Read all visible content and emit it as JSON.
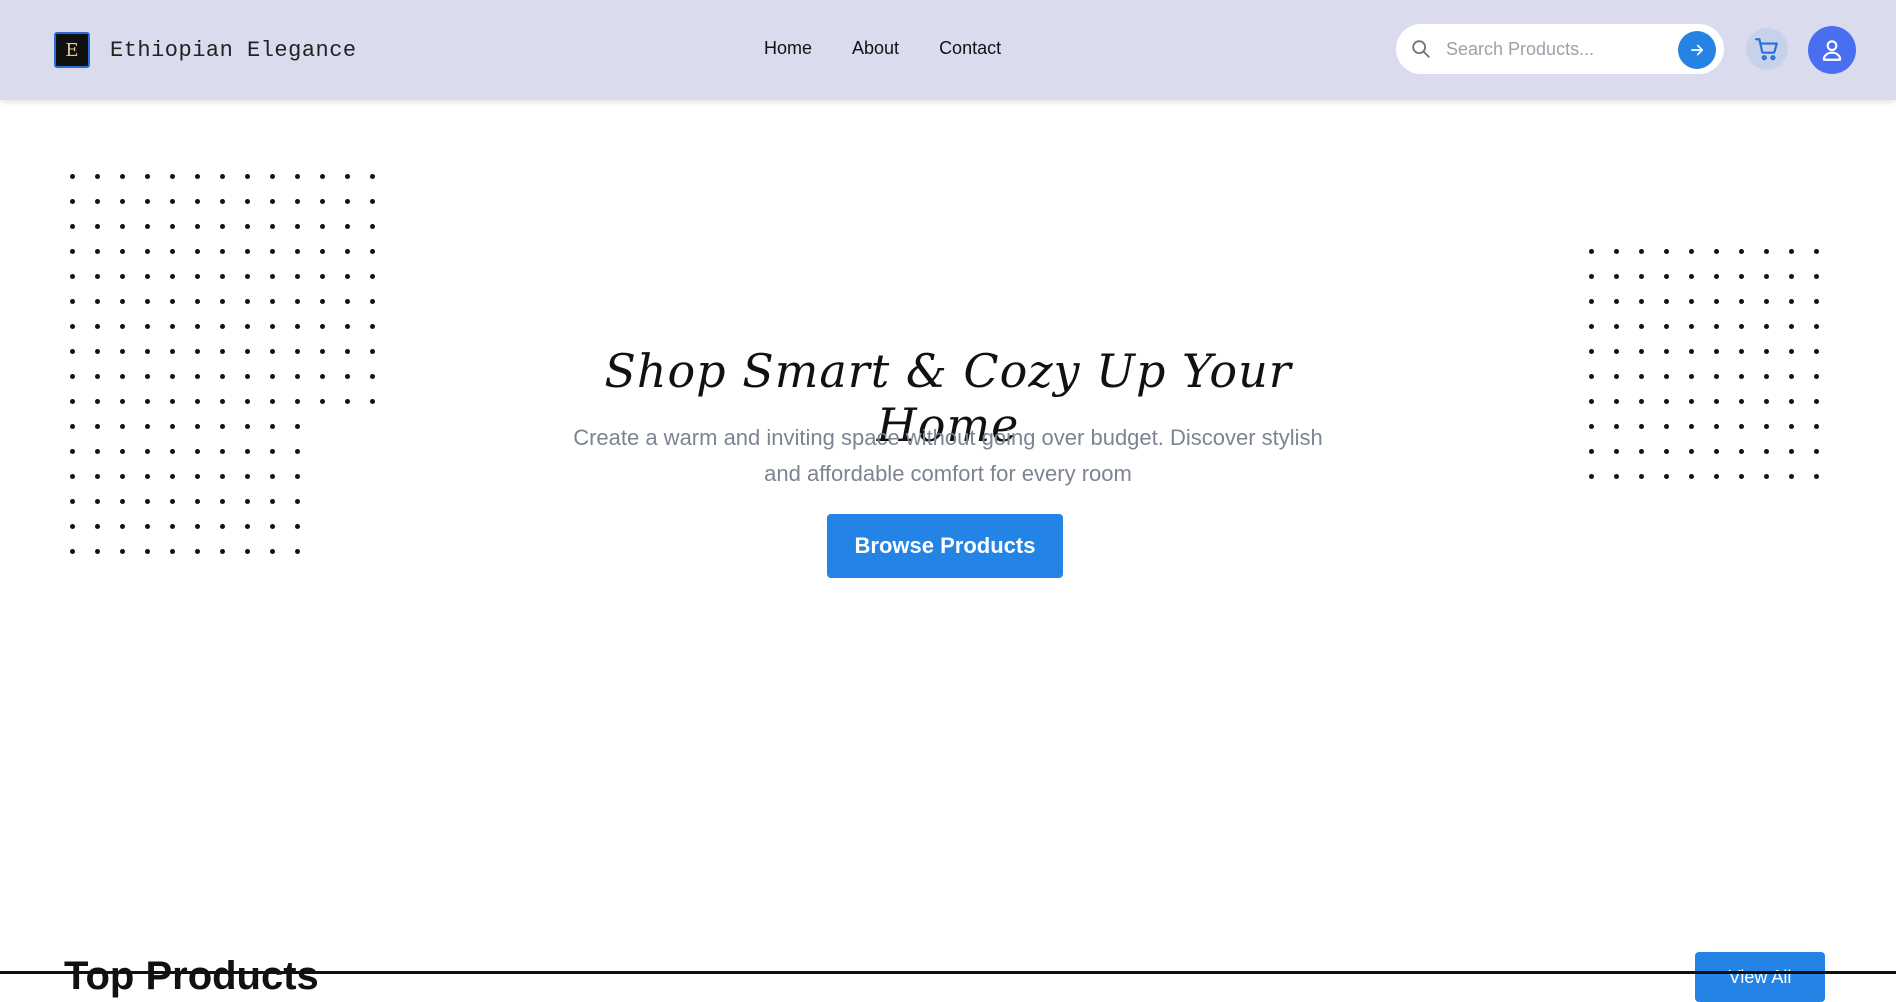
{
  "brand": {
    "logo_letter": "E",
    "name": "Ethiopian Elegance"
  },
  "nav": {
    "links": [
      "Home",
      "About",
      "Contact"
    ]
  },
  "search": {
    "placeholder": "Search Products...",
    "value": "",
    "icon": "search-icon",
    "submit_icon": "arrow-right-icon"
  },
  "header_actions": {
    "cart_icon": "cart-icon",
    "profile_icon": "user-icon"
  },
  "hero": {
    "title": "Shop Smart & Cozy Up Your Home",
    "subtitle": "Create a warm and inviting space without going over budget. Discover stylish and affordable comfort for every room",
    "cta_label": "Browse Products"
  },
  "products_section": {
    "title": "Top Products",
    "view_all_label": "View All"
  },
  "colors": {
    "navbar_bg": "#dadced",
    "accent": "#2384e6",
    "profile_bg": "#4a6ef0",
    "cart_bg": "#c7d2ea",
    "subtitle_text": "#7c8494",
    "dot_color": "#111111"
  }
}
